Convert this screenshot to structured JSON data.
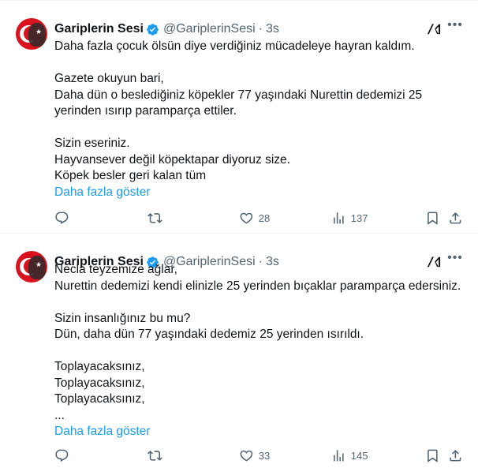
{
  "tweets": [
    {
      "author": "Gariplerin Sesi",
      "handle": "@GariplerinSesi",
      "separator": "·",
      "time": "3s",
      "lines": [
        "Daha fazla çocuk ölsün diye verdiğiniz mücadeleye hayran kaldım.",
        "",
        "Gazete okuyun bari,",
        "Daha dün o beslediğiniz köpekler 77 yaşındaki Nurettin dedemizi 25",
        "yerinden ısırıp paramparça ettiler.",
        "",
        "Sizin eseriniz.",
        "Hayvansever değil köpektapar diyoruz size.",
        "Köpek besler geri kalan tüm"
      ],
      "show_more": "Daha fazla göster",
      "likes": "28",
      "views": "137"
    },
    {
      "author": "Gariplerin Sesi",
      "handle": "@GariplerinSesi",
      "separator": "·",
      "time": "3s",
      "lines": [
        "Necla teyzemize ağlar,",
        "Nurettin dedemizi kendi elinizle 25 yerinden bıçaklar paramparça edersiniz.",
        "",
        "Sizin insanlığınız bu mu?",
        "Dün, daha dün 77 yaşındaki dedemiz 25 yerinden ısırıldı.",
        "",
        "Toplayacaksınız,",
        "Toplayacaksınız,",
        "Toplayacaksınız,",
        "..."
      ],
      "show_more": "Daha fazla göster",
      "likes": "33",
      "views": "145"
    }
  ],
  "icons": {
    "verified": "verified-badge-icon",
    "grok": "grok-icon",
    "more": "more-icon",
    "reply": "reply-icon",
    "repost": "repost-icon",
    "like": "like-icon",
    "views": "views-icon",
    "bookmark": "bookmark-icon",
    "share": "share-icon"
  },
  "colors": {
    "accent": "#1d9bf0",
    "text": "#0f1419",
    "muted": "#536471",
    "border": "#eff3f4"
  }
}
